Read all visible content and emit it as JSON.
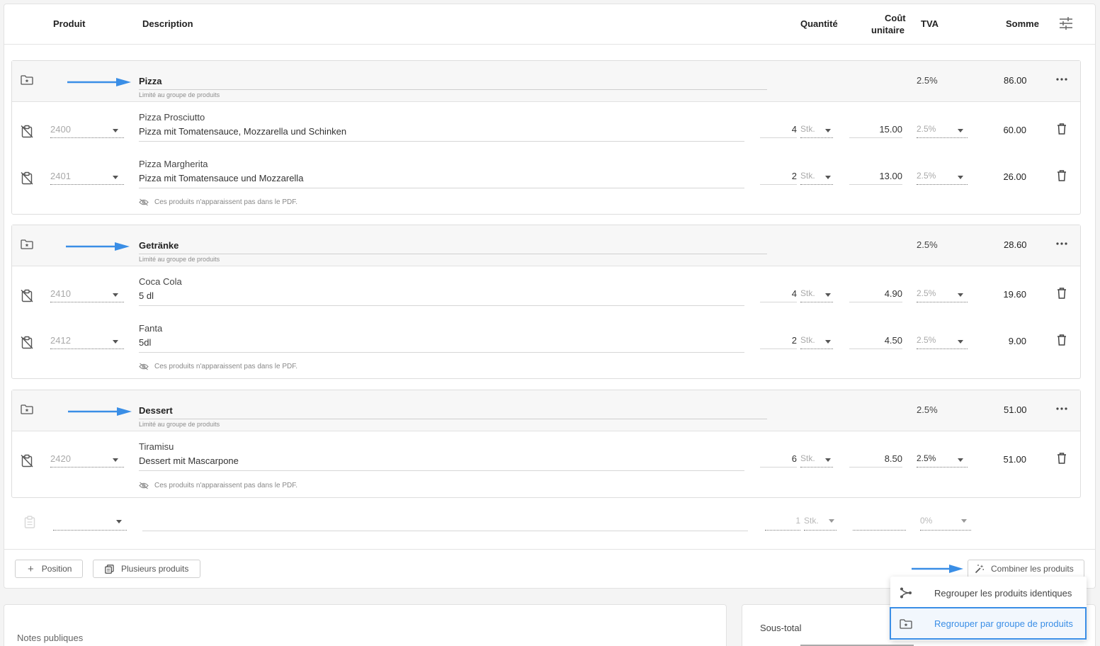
{
  "header": {
    "produit": "Produit",
    "description": "Description",
    "quantite": "Quantité",
    "cout_line1": "Coût",
    "cout_line2": "unitaire",
    "tva": "TVA",
    "somme": "Somme"
  },
  "groups": [
    {
      "title": "Pizza",
      "subtitle": "Limité au groupe de produits",
      "tva": "2.5%",
      "sum": "86.00",
      "note": "Ces produits n'apparaissent pas dans le PDF.",
      "items": [
        {
          "code": "2400",
          "name": "Pizza Prosciutto",
          "desc": "Pizza mit Tomatensauce, Mozzarella und Schinken",
          "qty": "4",
          "unit": "Stk.",
          "price": "15.00",
          "tva": "2.5%",
          "sum": "60.00"
        },
        {
          "code": "2401",
          "name": "Pizza Margherita",
          "desc": "Pizza mit Tomatensauce und Mozzarella",
          "qty": "2",
          "unit": "Stk.",
          "price": "13.00",
          "tva": "2.5%",
          "sum": "26.00"
        }
      ]
    },
    {
      "title": "Getränke",
      "subtitle": "Limité au groupe de produits",
      "tva": "2.5%",
      "sum": "28.60",
      "note": "Ces produits n'apparaissent pas dans le PDF.",
      "items": [
        {
          "code": "2410",
          "name": "Coca Cola",
          "desc": "5 dl",
          "qty": "4",
          "unit": "Stk.",
          "price": "4.90",
          "tva": "2.5%",
          "sum": "19.60"
        },
        {
          "code": "2412",
          "name": "Fanta",
          "desc": "5dl",
          "qty": "2",
          "unit": "Stk.",
          "price": "4.50",
          "tva": "2.5%",
          "sum": "9.00"
        }
      ]
    },
    {
      "title": "Dessert",
      "subtitle": "Limité au groupe de produits",
      "tva": "2.5%",
      "sum": "51.00",
      "note": "Ces produits n'apparaissent pas dans le PDF.",
      "items": [
        {
          "code": "2420",
          "name": "Tiramisu",
          "desc": "Dessert mit Mascarpone",
          "qty": "6",
          "unit": "Stk.",
          "price": "8.50",
          "tva": "2.5%",
          "sum": "51.00"
        }
      ]
    }
  ],
  "new_row": {
    "qty": "1",
    "unit": "Stk.",
    "tva": "0%"
  },
  "footer": {
    "position_label": "Position",
    "plusieurs_label": "Plusieurs produits",
    "combiner_label": "Combiner les produits"
  },
  "menu": {
    "item1": "Regrouper les produits identiques",
    "item2": "Regrouper par groupe de produits"
  },
  "bottom": {
    "notes_label": "Notes publiques",
    "subtotal_label": "Sous-total"
  },
  "colors": {
    "accent": "#3a8ee6",
    "arrow": "#3a8ee6",
    "highlight_border": "#3a8ee6"
  }
}
